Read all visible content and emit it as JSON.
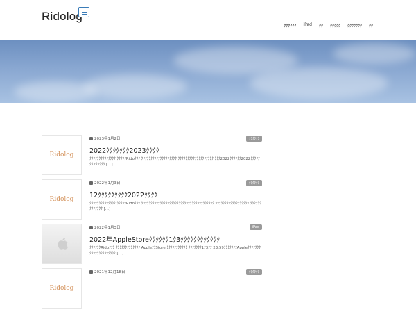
{
  "header": {
    "logo": "Ridolog",
    "nav": [
      "ｸｸｸｸｸｸ",
      "iPad",
      "ｸｸ",
      "ｸｸｸｸｸ",
      "ｸｸｸｸｸｸｸ",
      "ｸｸ"
    ]
  },
  "posts": [
    {
      "date": "2023年1月2日",
      "tag": "ｸｸｸｸｸｸ",
      "title": "2022ｸｸｸｸｸｸｸ2023ｸｸｸｸ",
      "excerpt": "ｸｸｸｸｸｸｸｸｸｸｸｸｸｸ ｸｸｸｸｸRidoｸｸｸ ｸｸｸｸｸｸｸｸｸｸｸｸｸｸｸｸｸｸｸ ｸｸｸｸｸｸｸｸｸｸｸｸｸｸｸｸｸｸｸ ｸｸｸ2022ｸｸｸｸｸｸ2022ｸｸｸｸｸｸｸ2ｸｸｸｸｸ […]",
      "thumb": "Ridolog"
    },
    {
      "date": "2022年1月3日",
      "tag": "ｸｸｸｸｸｸ",
      "title": "12ｸｸｸｸｸｸｸｸｸ2022ｸｸｸｸ",
      "excerpt": "ｸｸｸｸｸｸｸｸｸｸｸｸｸｸ ｸｸｸｸｸRidoｸｸｸ ｸｸｸｸｸｸｸｸｸｸｸｸｸｸｸｸｸｸｸｸｸｸｸｸｸｸｸｸｸｸｸｸｸｸｸｸｸｸｸ ｸｸｸｸｸｸｸｸｸｸｸｸｸｸｸｸｸｸ ｸｸｸｸｸｸｸｸｸｸｸｸｸ […]",
      "thumb": "Ridolog"
    },
    {
      "date": "2022年1月3日",
      "tag": "iPad",
      "title": "2022年AppleStoreｸｸｸｸｸｸ1ｸ3ｸｸｸｸｸｸｸｸｸｸｸｸ",
      "excerpt": "ｸｸｸｸｸｸRidoｸｸｸ ｸｸｸｸｸｸｸｸｸｸｸｸｸ AppleｸｸStore ｸｸｸｸｸｸｸｸｸｸｸ ｸｸｸｸｸｸｸ1ｸ3ｸｸ 23:59ｸｸｸｸｸｸｸAppleｸｸｸｸｸｸｸｸｸｸｸｸｸｸｸｸｸｸｸｸｸ […]",
      "thumb": "apple"
    },
    {
      "date": "2021年12月18日",
      "tag": "ｸｸｸｸｸｸ",
      "title": "",
      "excerpt": "",
      "thumb": "Ridolog"
    }
  ]
}
